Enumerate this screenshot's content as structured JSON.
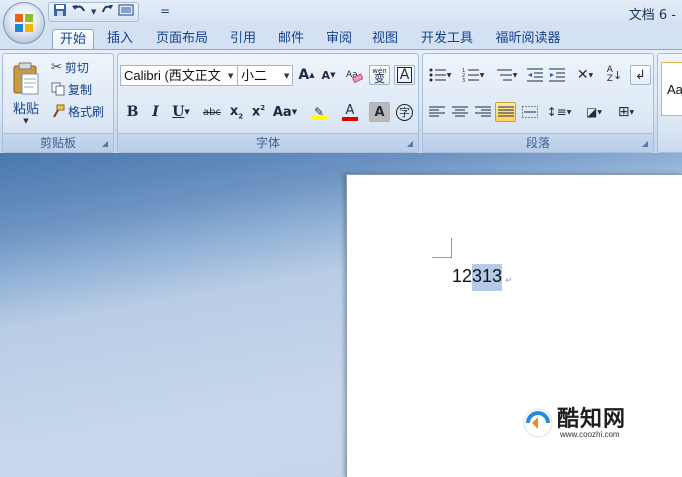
{
  "title_bar": {
    "document_title": "文档 6 -"
  },
  "quick_access": {
    "save_icon": "save-icon",
    "undo_icon": "undo-icon",
    "redo_icon": "redo-icon",
    "print_icon": "print-preview-icon",
    "customize": "="
  },
  "tabs": [
    {
      "label": "开始",
      "active": true
    },
    {
      "label": "插入"
    },
    {
      "label": "页面布局"
    },
    {
      "label": "引用"
    },
    {
      "label": "邮件"
    },
    {
      "label": "审阅"
    },
    {
      "label": "视图"
    },
    {
      "label": "开发工具"
    },
    {
      "label": "福昕阅读器"
    }
  ],
  "clipboard": {
    "paste": "粘贴",
    "cut": "剪切",
    "copy": "复制",
    "format_painter": "格式刷",
    "label": "剪贴板"
  },
  "font": {
    "font_name": "Calibri (西文正文",
    "font_size": "小二",
    "label": "字体",
    "grow": "A",
    "shrink": "A",
    "phonetic": "变",
    "bold": "B",
    "italic": "I",
    "underline": "U",
    "strikethrough": "abc",
    "subscript": "x",
    "superscript": "x",
    "subscript_mark": "2",
    "superscript_mark": "2",
    "change_case": "Aa",
    "font_color": "A",
    "char_shading": "A",
    "char_border": "A",
    "enclose": "字",
    "wen": "wén",
    "highlight_color": "#ffff00",
    "font_color_value": "#e00000"
  },
  "paragraph": {
    "label": "段落"
  },
  "styles": {
    "preview": "Aa"
  },
  "document": {
    "text_plain": "12",
    "text_selected": "313",
    "paragraph_mark": "↵"
  },
  "watermark": {
    "name": "酷知网",
    "url": "www.coozhi.com"
  }
}
